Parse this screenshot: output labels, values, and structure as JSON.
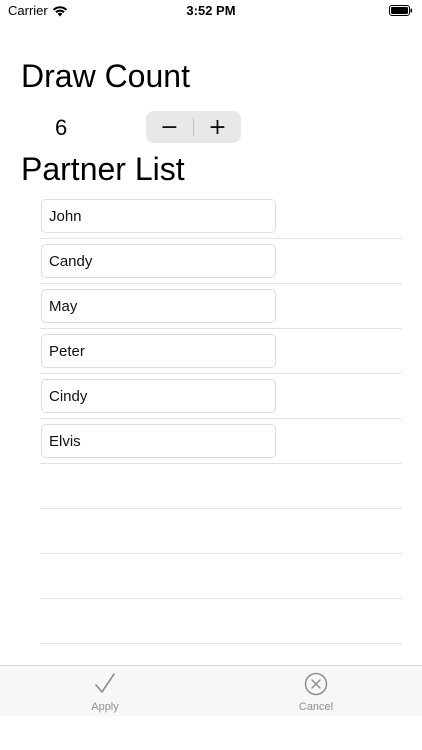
{
  "status_bar": {
    "carrier": "Carrier",
    "time": "3:52 PM"
  },
  "draw_count": {
    "heading": "Draw Count",
    "value": "6",
    "decrement_label": "−",
    "increment_label": "+"
  },
  "partner_list": {
    "heading": "Partner List",
    "partners": [
      "John",
      "Candy",
      "May",
      "Peter",
      "Cindy",
      "Elvis"
    ]
  },
  "toolbar": {
    "apply_label": "Apply",
    "cancel_label": "Cancel"
  },
  "colors": {
    "stepper_bg": "#e8e8ea",
    "toolbar_bg": "#f7f7f7",
    "toolbar_label": "#8e8e93"
  },
  "icons": {
    "status": [
      "wifi-icon",
      "battery-icon"
    ],
    "toolbar": [
      "checkmark-icon",
      "cancel-circle-icon"
    ]
  }
}
